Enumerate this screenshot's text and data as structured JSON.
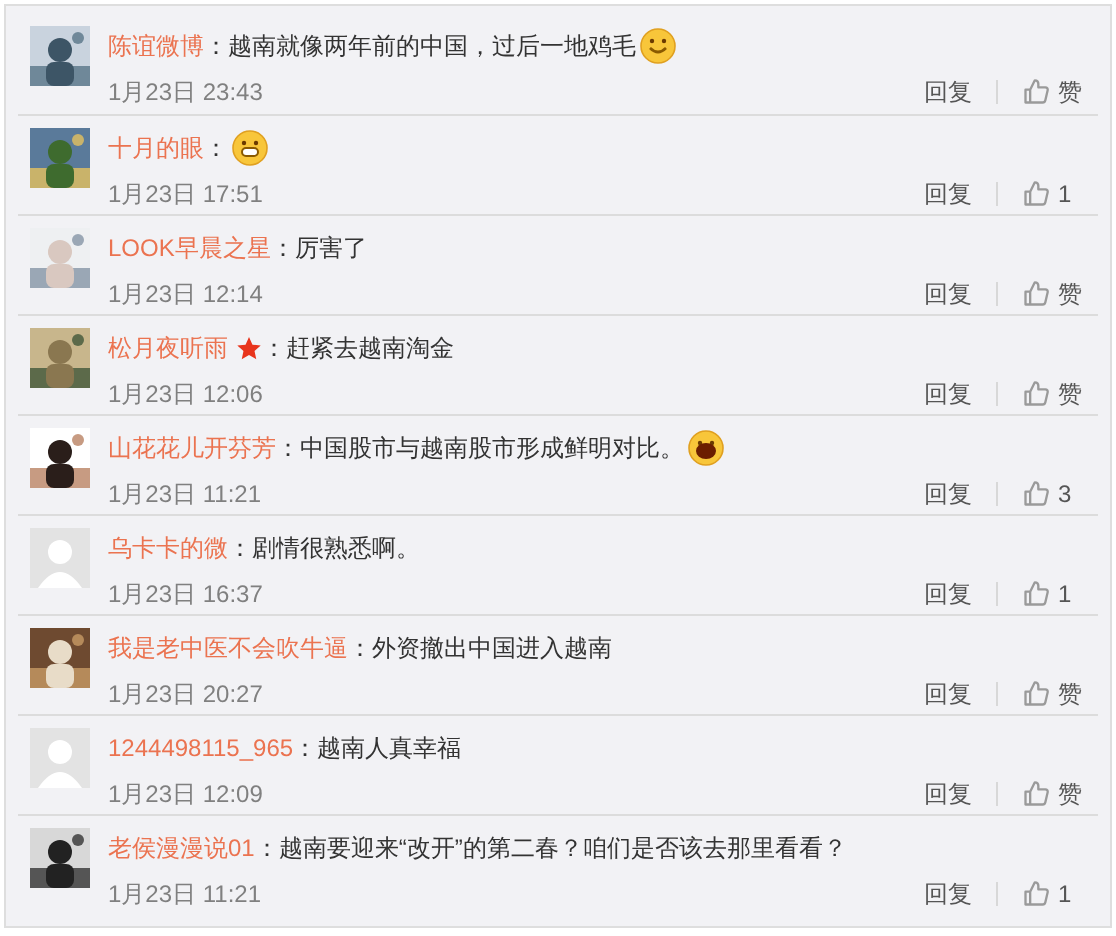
{
  "comments": [
    {
      "name": "陈谊微博",
      "badge": false,
      "text": "：越南就像两年前的中国，过后一地鸡毛",
      "emoji": {
        "kind": "smile"
      },
      "time": "1月23日 23:43",
      "reply": "回复",
      "likes": "赞"
    },
    {
      "name": "十月的眼",
      "badge": false,
      "text": "：",
      "emoji": {
        "kind": "grin"
      },
      "time": "1月23日 17:51",
      "reply": "回复",
      "likes": "1"
    },
    {
      "name": "LOOK早晨之星",
      "badge": false,
      "text": "：厉害了",
      "time": "1月23日 12:14",
      "reply": "回复",
      "likes": "赞"
    },
    {
      "name": "松月夜听雨",
      "badge": true,
      "text": "：赶紧去越南淘金",
      "time": "1月23日 12:06",
      "reply": "回复",
      "likes": "赞"
    },
    {
      "name": "山花花儿开芬芳",
      "badge": false,
      "text": "：中国股市与越南股市形成鲜明对比。",
      "emoji": {
        "kind": "laugh"
      },
      "time": "1月23日 11:21",
      "reply": "回复",
      "likes": "3"
    },
    {
      "avatar": {
        "kind": "default"
      },
      "name": "乌卡卡的微",
      "badge": false,
      "text": "：剧情很熟悉啊。",
      "time": "1月23日 16:37",
      "reply": "回复",
      "likes": "1"
    },
    {
      "name": "我是老中医不会吹牛逼",
      "badge": false,
      "text": "：外资撤出中国进入越南",
      "time": "1月23日 20:27",
      "reply": "回复",
      "likes": "赞"
    },
    {
      "avatar": {
        "kind": "default"
      },
      "name": "1244498115_965",
      "badge": false,
      "text": "：越南人真幸福",
      "time": "1月23日 12:09",
      "reply": "回复",
      "likes": "赞"
    },
    {
      "name": "老侯漫漫说01",
      "badge": false,
      "text": "：越南要迎来“改开”的第二春？咱们是否该去那里看看？",
      "time": "1月23日 11:21",
      "reply": "回复",
      "likes": "1"
    }
  ]
}
